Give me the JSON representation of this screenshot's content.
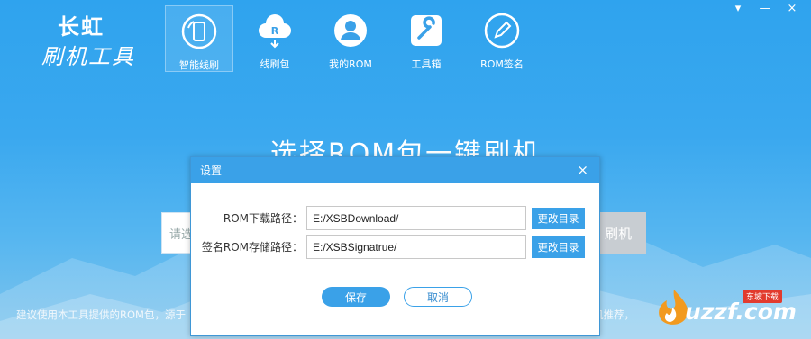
{
  "window_controls": {
    "minimize": "▾",
    "restore": "—",
    "close": "×"
  },
  "logo": {
    "line1": "长虹",
    "line2": "刷机工具"
  },
  "nav": [
    {
      "label": "智能线刷",
      "icon": "phone-refresh-icon",
      "active": true
    },
    {
      "label": "线刷包",
      "icon": "cloud-download-icon",
      "active": false
    },
    {
      "label": "我的ROM",
      "icon": "user-icon",
      "active": false
    },
    {
      "label": "工具箱",
      "icon": "wrench-icon",
      "active": false
    },
    {
      "label": "ROM签名",
      "icon": "pen-icon",
      "active": false
    }
  ],
  "headline": "选择ROM包一键刷机",
  "background": {
    "input_placeholder": "请选",
    "flash_button": "刷机",
    "note_left": "建议使用本工具提供的ROM包，源于",
    "note_right": "机推荐，"
  },
  "dialog": {
    "title": "设置",
    "close": "×",
    "rom_download_label": "ROM下载路径：",
    "rom_download_value": "E:/XSBDownload/",
    "signed_rom_label": "签名ROM存储路径：",
    "signed_rom_value": "E:/XSBSignatrue/",
    "change_dir_label": "更改目录",
    "save_label": "保存",
    "cancel_label": "取消"
  },
  "watermark": {
    "text": "uzzf.com",
    "tag": "东坡下载"
  },
  "colors": {
    "accent": "#3aa1e8",
    "background_top": "#2fa3ee"
  }
}
